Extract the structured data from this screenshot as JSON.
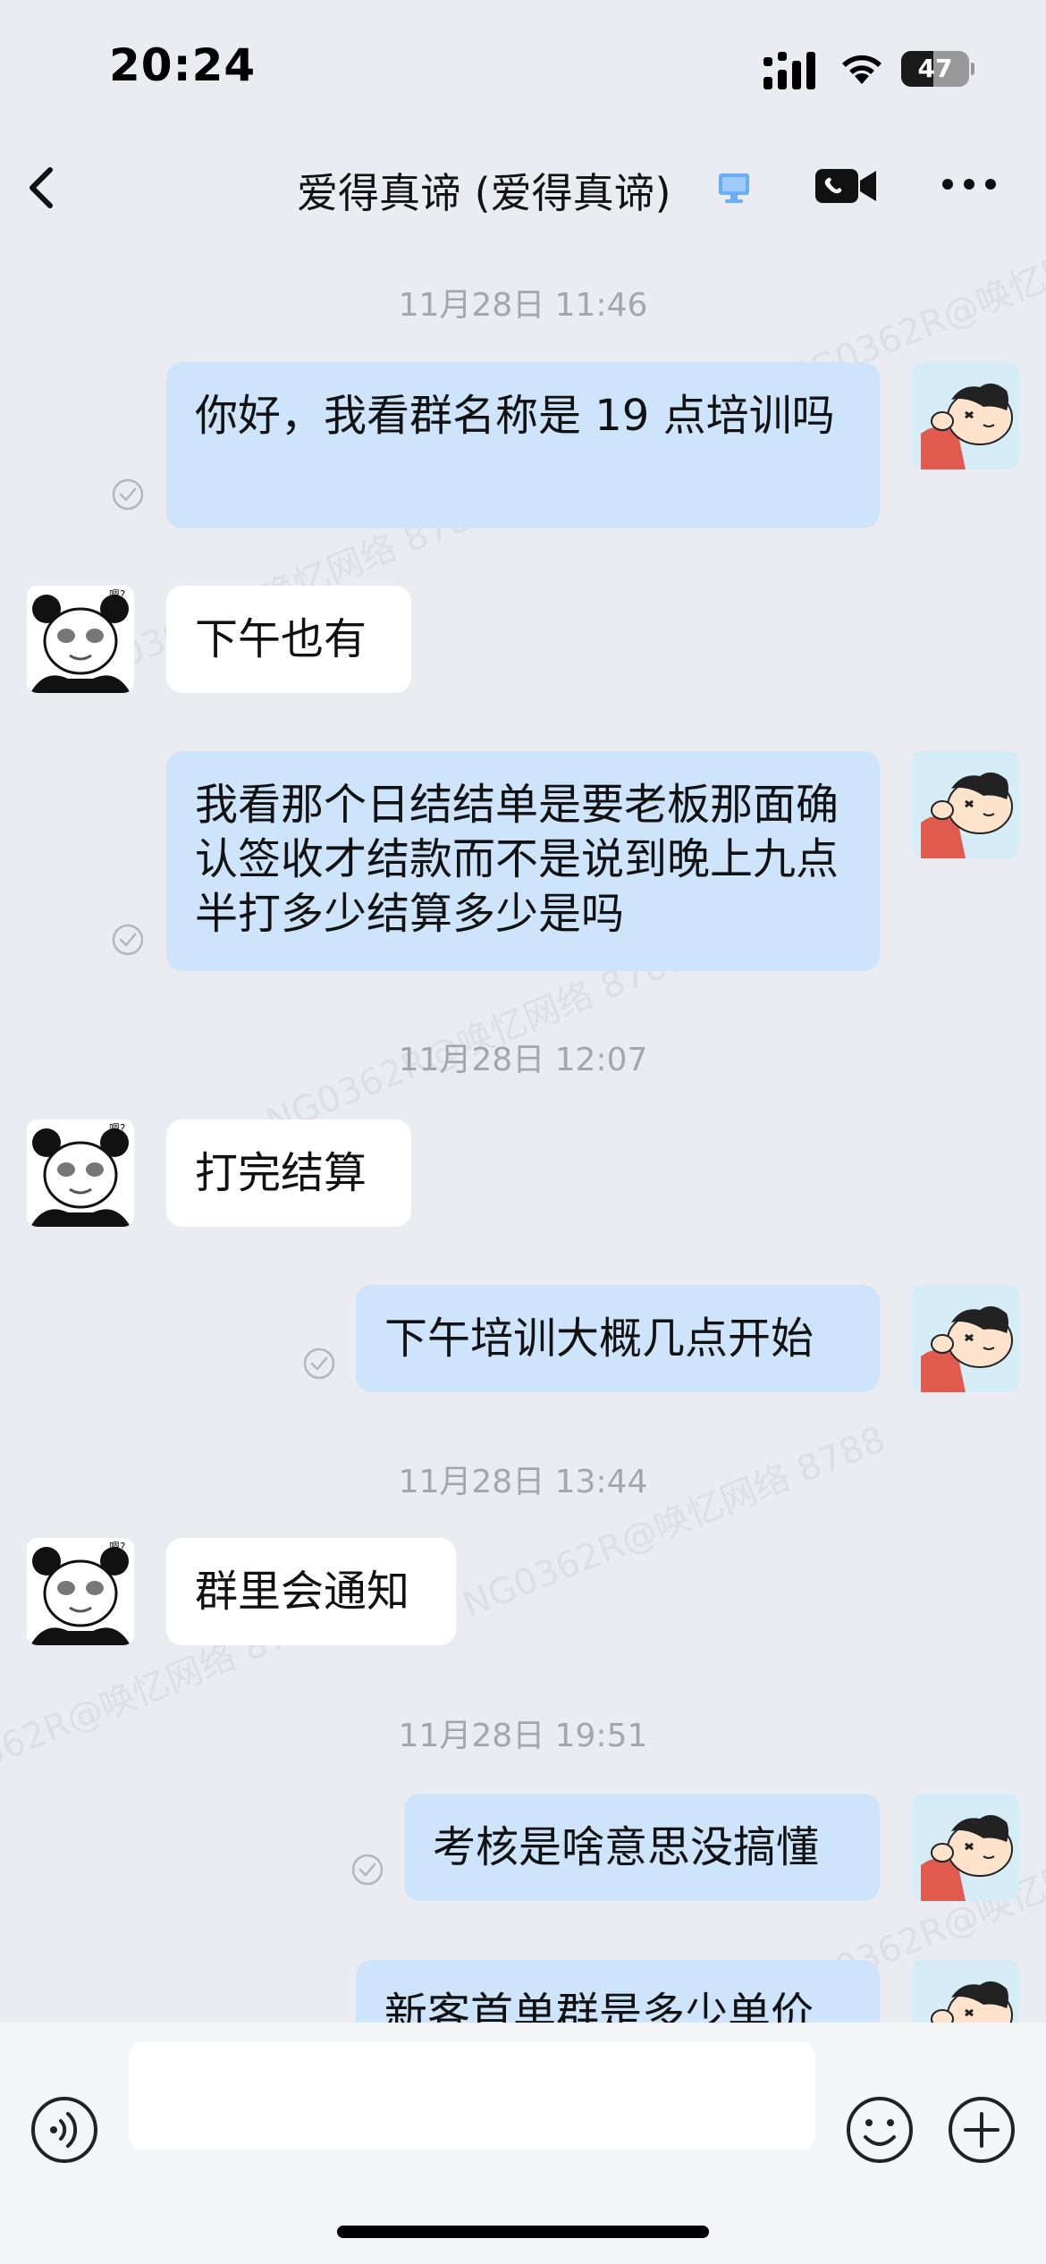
{
  "status_bar": {
    "time": "20:24",
    "battery_level": "47",
    "battery_fraction": 0.47
  },
  "header": {
    "title": "爱得真谛 (爱得真谛)"
  },
  "watermark_text": "NG0362R@唤忆网络 8788",
  "messages": [
    {
      "type": "timestamp",
      "text": "11月28日 11:46"
    },
    {
      "type": "outgoing",
      "text": "你好，我看群名称是 19 点培训吗",
      "status": "read"
    },
    {
      "type": "incoming",
      "text": "下午也有"
    },
    {
      "type": "outgoing",
      "text": "我看那个日结结单是要老板那面确认签收才结款而不是说到晚上九点半打多少结算多少是吗",
      "status": "read"
    },
    {
      "type": "timestamp",
      "text": "11月28日 12:07"
    },
    {
      "type": "incoming",
      "text": "打完结算"
    },
    {
      "type": "outgoing",
      "text": "下午培训大概几点开始",
      "status": "read"
    },
    {
      "type": "timestamp",
      "text": "11月28日 13:44"
    },
    {
      "type": "incoming",
      "text": "群里会通知"
    },
    {
      "type": "timestamp",
      "text": "11月28日 19:51"
    },
    {
      "type": "outgoing",
      "text": "考核是啥意思没搞懂",
      "status": "read"
    },
    {
      "type": "outgoing",
      "text": "新客首单群是多少单价"
    }
  ],
  "input": {
    "placeholder": ""
  },
  "icons": {
    "back": "chevron-left-icon",
    "desktop": "desktop-online-icon",
    "video_call": "video-call-icon",
    "more": "more-dots-icon",
    "voice": "voice-icon",
    "emoji": "emoji-icon",
    "plus": "plus-icon"
  },
  "colors": {
    "background": "#ebecf1",
    "outgoing_bubble": "#cde4fb",
    "incoming_bubble": "#ffffff",
    "timestamp_text": "#a3a6ad",
    "desktop_icon": "#6aaef5"
  }
}
